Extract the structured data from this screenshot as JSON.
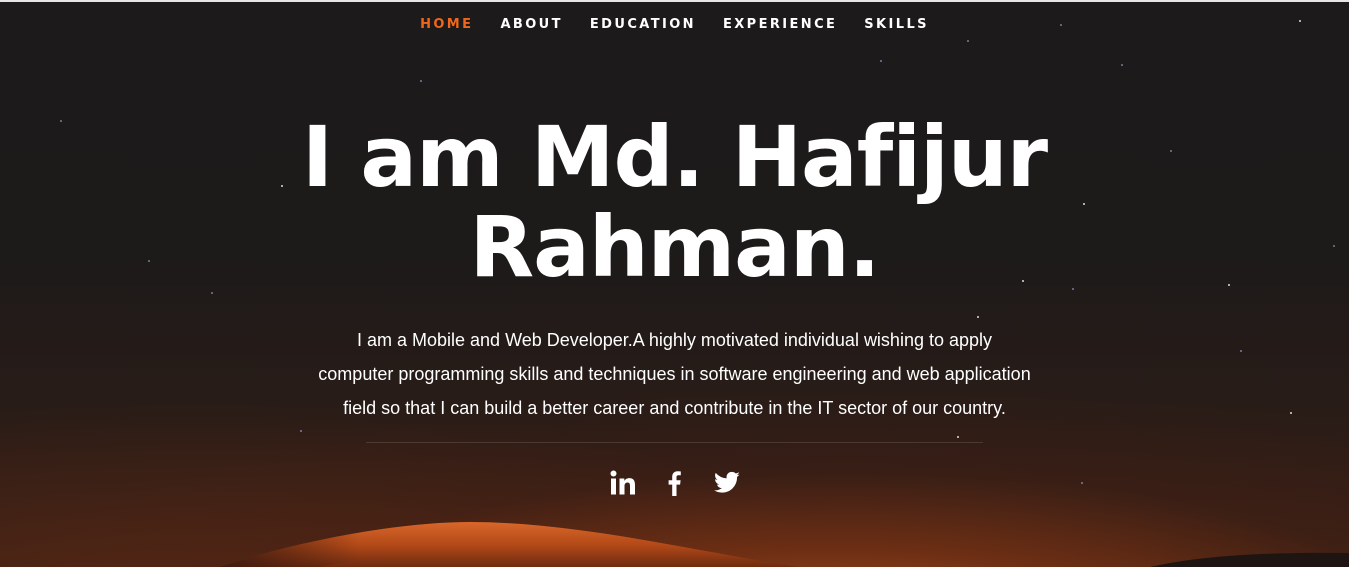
{
  "nav": {
    "items": [
      {
        "label": "HOME",
        "active": true
      },
      {
        "label": "ABOUT",
        "active": false
      },
      {
        "label": "EDUCATION",
        "active": false
      },
      {
        "label": "EXPERIENCE",
        "active": false
      },
      {
        "label": "SKILLS",
        "active": false
      }
    ]
  },
  "hero": {
    "title_line1": "I am Md. Hafijur",
    "title_line2": "Rahman.",
    "intro_line1": "I am a Mobile and Web Developer.A highly motivated individual wishing to apply",
    "intro_line2": "computer programming skills and techniques in software engineering and web application",
    "intro_line3": "field so that I can build a better career and contribute in the IT sector of our country."
  },
  "social": [
    {
      "icon": "linkedin-icon"
    },
    {
      "icon": "facebook-icon"
    },
    {
      "icon": "twitter-icon"
    }
  ],
  "colors": {
    "accent": "#f0661a",
    "text": "#ffffff",
    "background": "#1c1a1b",
    "dune": "#c4561c"
  }
}
